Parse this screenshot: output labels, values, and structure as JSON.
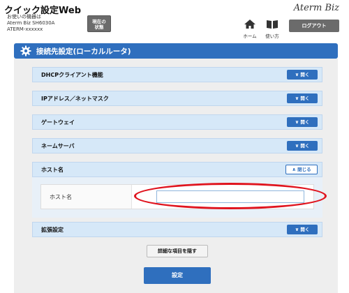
{
  "header": {
    "title": "クイック設定Web",
    "device_line1": "お使いの機器は",
    "device_line2": "Aterm Biz SH6030A",
    "device_line3": "ATERM-xxxxxx",
    "status_line1": "現在の",
    "status_line2": "状態",
    "brand": "Aterm Biz",
    "home_label": "ホーム",
    "manual_label": "使い方",
    "logout_label": "ログアウト"
  },
  "section": {
    "title": "接続先設定(ローカルルータ)",
    "icon": "gear-icon"
  },
  "accordions": [
    {
      "label": "DHCPクライアント機能",
      "button": "開く"
    },
    {
      "label": "IPアドレス／ネットマスク",
      "button": "開く"
    },
    {
      "label": "ゲートウェイ",
      "button": "開く"
    },
    {
      "label": "ネームサーバ",
      "button": "開く"
    },
    {
      "label": "ホスト名",
      "button": "閉じる"
    },
    {
      "label": "拡張設定",
      "button": "開く"
    }
  ],
  "host_name": {
    "field_label": "ホスト名",
    "value": ""
  },
  "actions": {
    "hide_details": "詳細な項目を隠す",
    "submit": "設定"
  },
  "colors": {
    "accent": "#2f6fbe",
    "highlight": "#e0141e",
    "accordion_bg": "#d6e8f8"
  }
}
